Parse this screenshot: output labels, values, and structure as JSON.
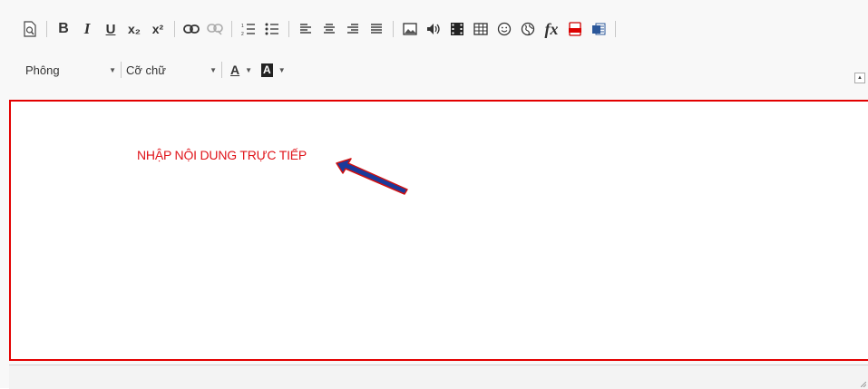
{
  "toolbar": {
    "row1": [
      {
        "name": "preview-icon",
        "group": 1
      },
      {
        "name": "bold-icon",
        "glyph": "B",
        "group": 1
      },
      {
        "name": "italic-icon",
        "glyph": "I",
        "group": 1
      },
      {
        "name": "underline-icon",
        "glyph": "U",
        "group": 1
      },
      {
        "name": "subscript-icon",
        "glyph": "x₂",
        "group": 1
      },
      {
        "name": "superscript-icon",
        "glyph": "x²",
        "group": 1
      },
      {
        "name": "link-icon",
        "group": 2
      },
      {
        "name": "unlink-icon",
        "group": 2
      },
      {
        "name": "numbered-list-icon",
        "group": 3
      },
      {
        "name": "bulleted-list-icon",
        "group": 3
      },
      {
        "name": "align-left-icon",
        "group": 4
      },
      {
        "name": "align-center-icon",
        "group": 4
      },
      {
        "name": "align-right-icon",
        "group": 4
      },
      {
        "name": "align-justify-icon",
        "group": 4
      },
      {
        "name": "image-icon",
        "group": 5
      },
      {
        "name": "audio-icon",
        "group": 5
      },
      {
        "name": "video-icon",
        "group": 5
      },
      {
        "name": "table-icon",
        "group": 5
      },
      {
        "name": "smiley-icon",
        "group": 5
      },
      {
        "name": "globe-icon",
        "group": 5
      },
      {
        "name": "formula-icon",
        "glyph": "fx",
        "group": 5
      },
      {
        "name": "pdf-icon",
        "group": 5
      },
      {
        "name": "word-icon",
        "group": 5
      }
    ],
    "font_label": "Phông",
    "size_label": "Cỡ chữ",
    "text_color_glyph": "A",
    "bg_color_glyph": "A"
  },
  "content": {
    "text": "NHẬP NỘI DUNG TRỰC TIẾP"
  },
  "colors": {
    "border": "#e30000",
    "text": "#e0141a",
    "arrow_fill": "#1a3a9a",
    "arrow_outline": "#d01010"
  }
}
